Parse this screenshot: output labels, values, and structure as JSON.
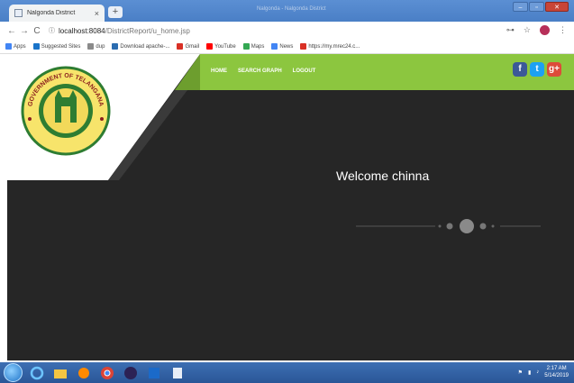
{
  "browser": {
    "tab_title": "Nalgonda District",
    "tab_close": "×",
    "new_tab": "+",
    "faint_title": "Nalgonda - Nalgonda District",
    "url_host": "localhost:8084",
    "url_path": "/DistrictReport/u_home.jsp",
    "nav": {
      "back": "←",
      "forward": "→",
      "reload": "C",
      "info": "ⓘ"
    },
    "addr_icons": {
      "key": "⊶",
      "star": "☆",
      "menu": "⋮"
    },
    "window_controls": {
      "minimize": "–",
      "maximize": "▫",
      "close": "✕"
    }
  },
  "bookmarks": [
    {
      "label": "Apps",
      "icon": "apps-icon",
      "color": "#4285f4"
    },
    {
      "label": "Suggested Sites",
      "icon": "bookmark-icon",
      "color": "#1a74c9"
    },
    {
      "label": "dup",
      "icon": "page-icon",
      "color": "#8a8a8a"
    },
    {
      "label": "Download apache-...",
      "icon": "download-icon",
      "color": "#2b6cb0"
    },
    {
      "label": "Gmail",
      "icon": "gmail-icon",
      "color": "#d93025"
    },
    {
      "label": "YouTube",
      "icon": "youtube-icon",
      "color": "#ff0000"
    },
    {
      "label": "Maps",
      "icon": "maps-icon",
      "color": "#34a853"
    },
    {
      "label": "News",
      "icon": "news-icon",
      "color": "#4285f4"
    },
    {
      "label": "https://my.mrec24.c...",
      "icon": "gmail-icon",
      "color": "#d93025"
    }
  ],
  "nav": {
    "home": "HOME",
    "search_graph": "SEARCH GRAPH",
    "logout": "LOGOUT"
  },
  "social": {
    "facebook": "f",
    "twitter": "t",
    "google": "g+"
  },
  "emblem": {
    "top_text": "GOVERNMENT OF TELANGANA"
  },
  "welcome": "Welcome chinna",
  "colors": {
    "accent": "#8cc63f",
    "page_bg": "#262626"
  },
  "taskbar": {
    "time": "2:17 AM",
    "date": "5/14/2019"
  }
}
